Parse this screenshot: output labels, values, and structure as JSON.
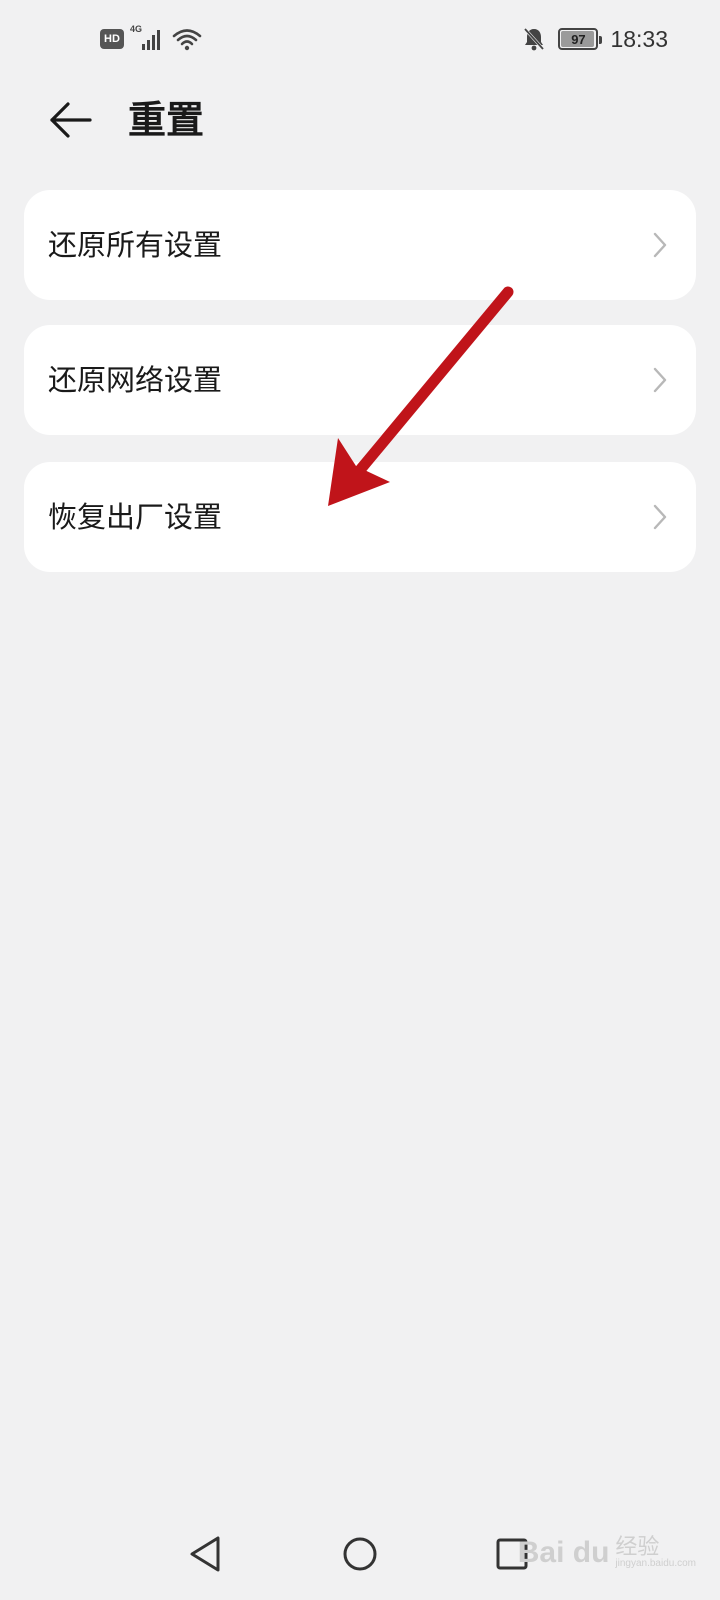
{
  "status_bar": {
    "hd_label": "HD",
    "network_label": "4G",
    "battery_level": 97,
    "battery_text": "97",
    "time": "18:33",
    "icons": [
      "hd-badge",
      "cellular-signal-icon",
      "wifi-icon",
      "bell-muted-icon",
      "battery-icon"
    ]
  },
  "header": {
    "title": "重置",
    "back_icon": "back-arrow-icon"
  },
  "menu": {
    "items": [
      {
        "label": "还原所有设置"
      },
      {
        "label": "还原网络设置"
      },
      {
        "label": "恢复出厂设置"
      }
    ],
    "chevron_icon": "chevron-right-icon"
  },
  "annotation": {
    "arrow_color": "#c0141a"
  },
  "nav_bar": {
    "icons": [
      "nav-back-icon",
      "nav-home-icon",
      "nav-recents-icon"
    ]
  },
  "watermark": {
    "logo": "Bai du",
    "cn": "经验",
    "url": "jingyan.baidu.com"
  },
  "colors": {
    "background": "#f1f1f2",
    "card": "#ffffff",
    "text": "#1a1a1a",
    "chevron": "#b8b8b8"
  }
}
